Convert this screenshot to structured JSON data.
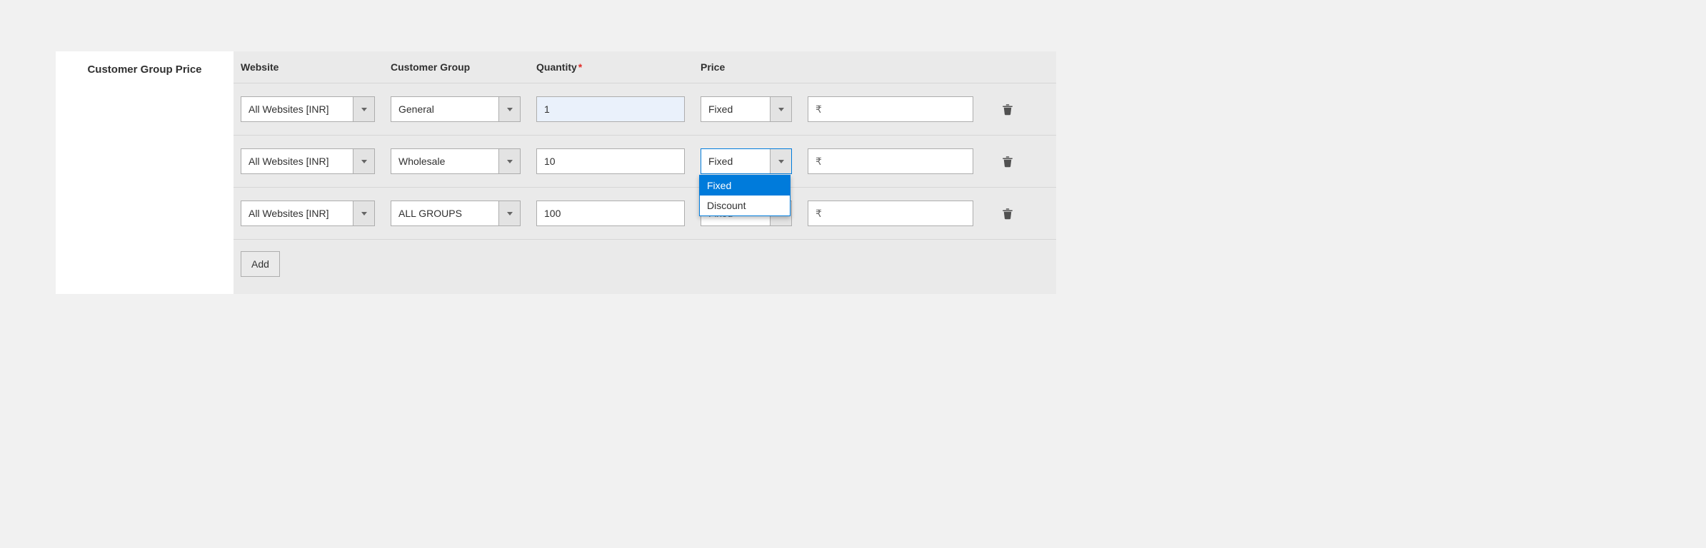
{
  "section_label": "Customer Group Price",
  "columns": {
    "website": "Website",
    "cgroup": "Customer Group",
    "qty": "Quantity",
    "price": "Price",
    "required_mark": "*"
  },
  "rows": [
    {
      "website": "All Websites [INR]",
      "cgroup": "General",
      "qty": "1",
      "price_type": "Fixed",
      "currency_symbol": "₹",
      "price": ""
    },
    {
      "website": "All Websites [INR]",
      "cgroup": "Wholesale",
      "qty": "10",
      "price_type": "Fixed",
      "currency_symbol": "₹",
      "price": ""
    },
    {
      "website": "All Websites [INR]",
      "cgroup": "ALL GROUPS",
      "qty": "100",
      "price_type": "Fixed",
      "currency_symbol": "₹",
      "price": ""
    }
  ],
  "dropdown_open": {
    "row_index": 1,
    "options": [
      "Fixed",
      "Discount"
    ],
    "selected": "Fixed"
  },
  "add_button_label": "Add"
}
